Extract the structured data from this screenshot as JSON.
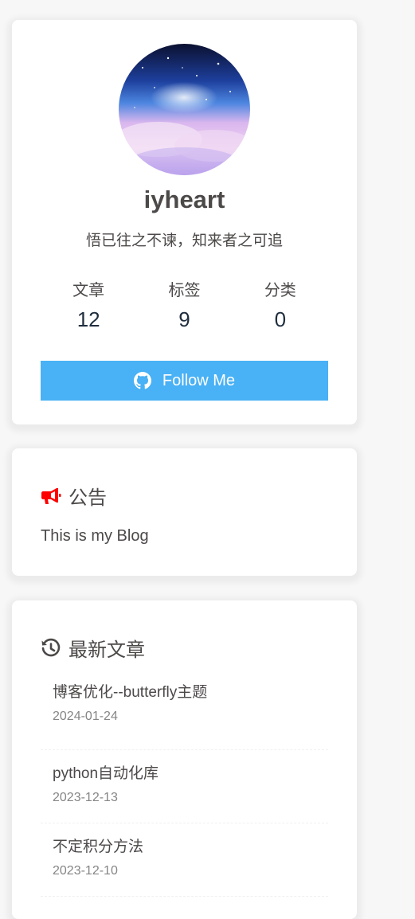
{
  "author": {
    "name": "iyheart",
    "description": "悟已往之不谏，知来者之可追",
    "stats": [
      {
        "label": "文章",
        "value": "12"
      },
      {
        "label": "标签",
        "value": "9"
      },
      {
        "label": "分类",
        "value": "0"
      }
    ],
    "follow_label": "Follow Me",
    "follow_icon": "github-icon",
    "button_color": "#49b1f5"
  },
  "announcement": {
    "heading": "公告",
    "icon": "bullhorn-icon",
    "icon_color": "#ff0000",
    "text": "This is my Blog"
  },
  "recent_posts": {
    "heading": "最新文章",
    "icon": "history-icon",
    "items": [
      {
        "title": "博客优化--butterfly主题",
        "date": "2024-01-24"
      },
      {
        "title": "python自动化库",
        "date": "2023-12-13"
      },
      {
        "title": "不定积分方法",
        "date": "2023-12-10"
      }
    ]
  }
}
